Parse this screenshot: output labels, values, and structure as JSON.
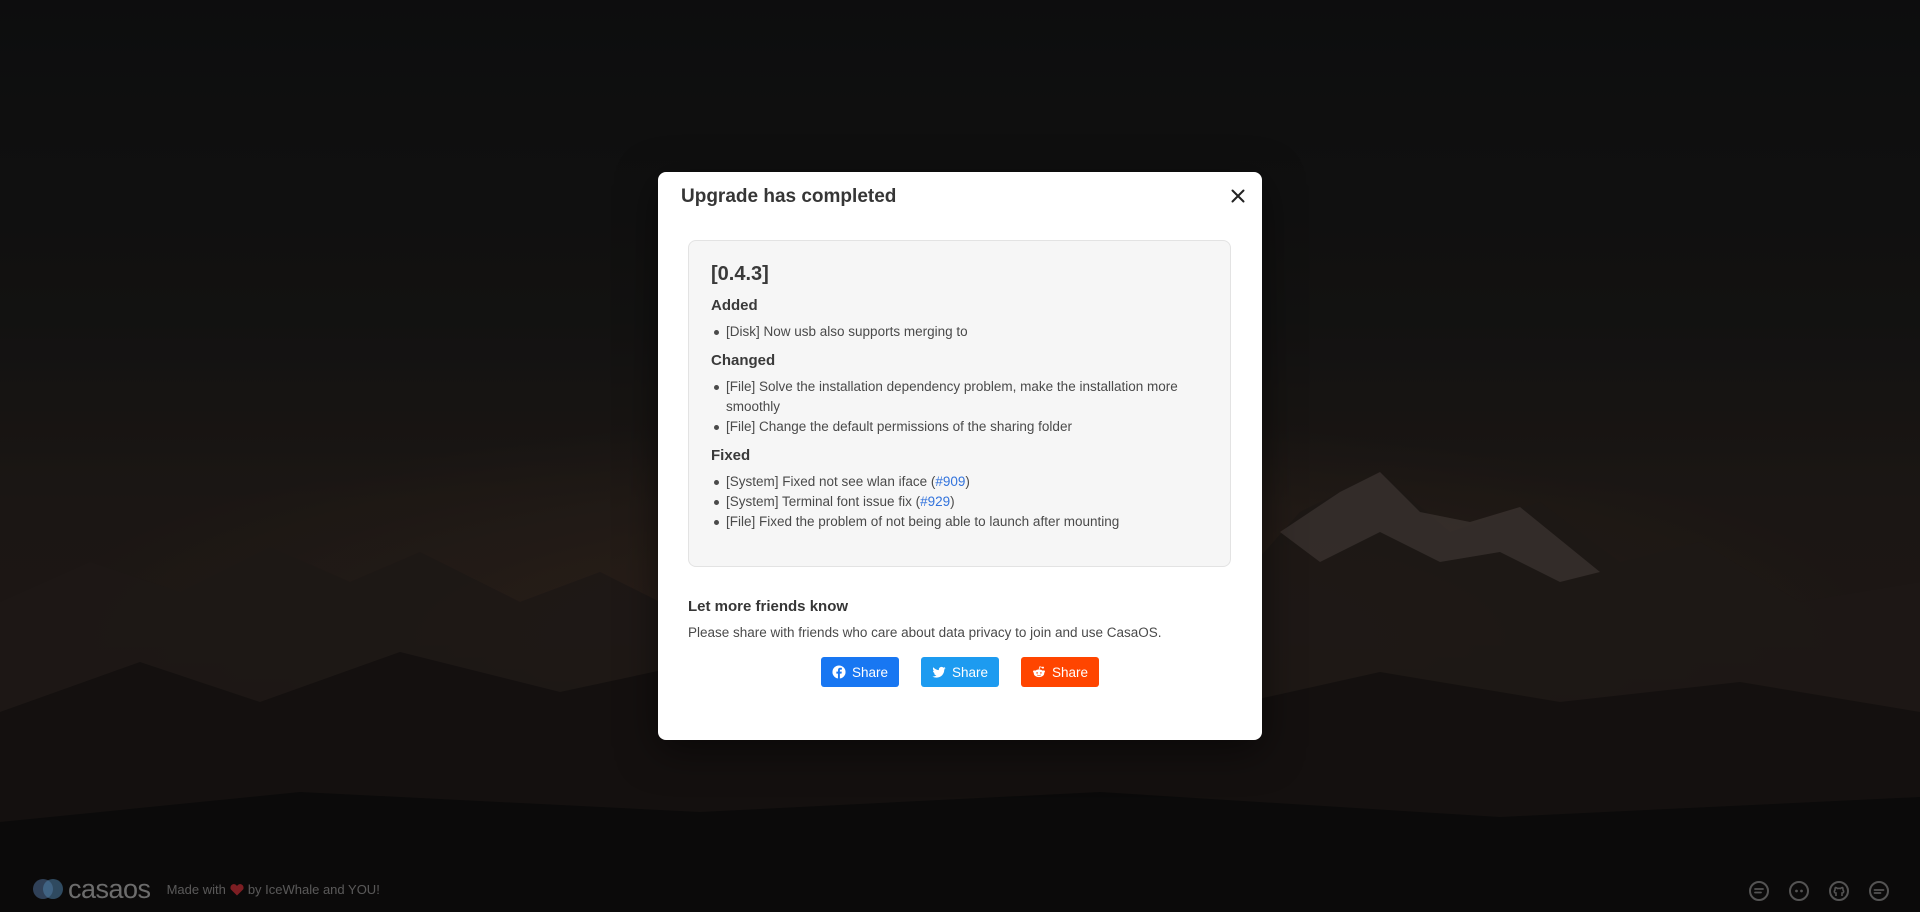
{
  "modal": {
    "title": "Upgrade has completed",
    "close_icon": "close-icon"
  },
  "changelog": {
    "version": "[0.4.3]",
    "sections": [
      {
        "heading": "Added",
        "items": [
          {
            "text": "[Disk] Now usb also supports merging to"
          }
        ]
      },
      {
        "heading": "Changed",
        "items": [
          {
            "text": "[File] Solve the installation dependency problem, make the installation more smoothly"
          },
          {
            "text": "[File] Change the default permissions of the sharing folder"
          }
        ]
      },
      {
        "heading": "Fixed",
        "items": [
          {
            "prefix": "[System] Fixed not see wlan iface (",
            "link": "#909",
            "suffix": ")"
          },
          {
            "prefix": "[System] Terminal font issue fix (",
            "link": "#929",
            "suffix": ")"
          },
          {
            "text": "[File] Fixed the problem of not being able to launch after mounting"
          }
        ]
      }
    ]
  },
  "share": {
    "title": "Let more friends know",
    "description": "Please share with friends who care about data privacy to join and use CasaOS.",
    "buttons": [
      {
        "label": "Share",
        "icon": "facebook-icon",
        "color": "#3b5998"
      },
      {
        "label": "Share",
        "icon": "twitter-icon",
        "color": "#1da1f2"
      },
      {
        "label": "Share",
        "icon": "reddit-icon",
        "color": "#ff4500"
      }
    ]
  },
  "footer": {
    "logo_text": "casaos",
    "made_with_prefix": "Made with",
    "made_with_suffix": "by IceWhale and YOU!",
    "icons": [
      "forum-icon",
      "discord-icon",
      "github-icon",
      "chat-icon"
    ]
  },
  "colors": {
    "link": "#3273dc",
    "facebook": "#1877f2",
    "twitter": "#1d9bf0",
    "reddit": "#ff4500"
  }
}
